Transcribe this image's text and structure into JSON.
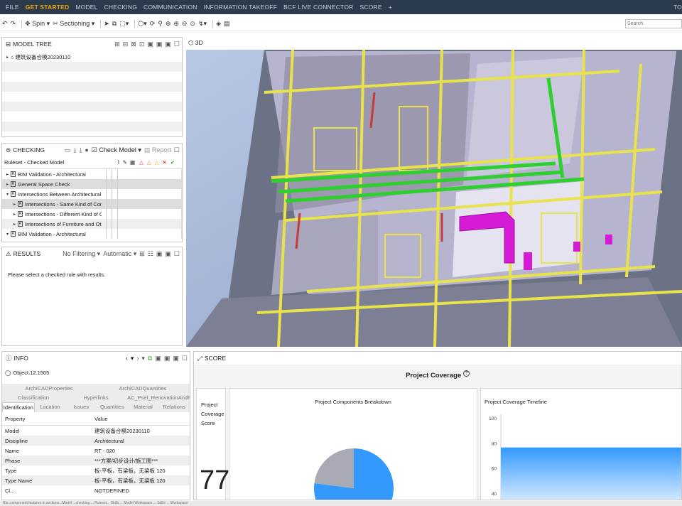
{
  "menu": {
    "items": [
      "FILE",
      "GET STARTED",
      "MODEL",
      "CHECKING",
      "COMMUNICATION",
      "INFORMATION TAKEOFF",
      "BCF LIVE CONNECTOR",
      "SCORE",
      "+"
    ],
    "right": "TO"
  },
  "toolbar": {
    "spin": "Spin",
    "sectioning": "Sectioning",
    "search_placeholder": "Search"
  },
  "model_tree": {
    "title": "MODEL TREE",
    "root": "建筑设备合模20230110"
  },
  "view3d": {
    "label": "3D"
  },
  "checking": {
    "title": "CHECKING",
    "check_model": "Check Model",
    "report": "Report",
    "col": "Ruleset - Checked Model",
    "rows": [
      "BIM Validation - Architectural",
      "General Space Check",
      "Intersections Between Architectural Compo",
      "Intersections - Same Kind of Componen",
      "Intersections - Different Kind of Compo",
      "Intersections of Furniture and Other Ob",
      "BIM Validation - Architectural"
    ]
  },
  "results": {
    "title": "RESULTS",
    "filter": "No Filtering",
    "mode": "Automatic",
    "message": "Please select a checked rule with results."
  },
  "info": {
    "title": "INFO",
    "object": "Object.12.1505",
    "tabs_row1": [
      "ArchiCADProperties",
      "ArchiCADQuantities"
    ],
    "tabs_row2": [
      "Classification",
      "Hyperlinks",
      "AC_Pset_RenovationAndPhasing"
    ],
    "tabs_row3": [
      "Identification",
      "Location",
      "Issues",
      "Quantities",
      "Material",
      "Relations"
    ],
    "col_property": "Property",
    "col_value": "Value",
    "rows": [
      [
        "Model",
        "建筑设备合模20230110"
      ],
      [
        "Discipline",
        "Architectural"
      ],
      [
        "Name",
        "RT - 020"
      ],
      [
        "Phase",
        "***方案/初步设计/施工图***"
      ],
      [
        "Type",
        "板-平板，有梁板，无梁板 120"
      ],
      [
        "Type Name",
        "板-平板，有梁板，无梁板 120"
      ],
      [
        "Cl...",
        "NOTDEFINED"
      ]
    ]
  },
  "score": {
    "title": "SCORE",
    "heading": "Project Coverage",
    "help": "?",
    "card_label": [
      "Project",
      "Coverage",
      "Score"
    ],
    "value": "77",
    "breakdown_title": "Project Components Breakdown",
    "timeline_title": "Project Coverage Timeline"
  },
  "chart_data": [
    {
      "type": "pie",
      "title": "Project Components Breakdown",
      "values": [
        77,
        23
      ],
      "colors": [
        "#3399ff",
        "#a8aab3"
      ]
    },
    {
      "type": "area",
      "title": "Project Coverage Timeline",
      "yticks": [
        100,
        80,
        60,
        40
      ],
      "ylim": [
        40,
        100
      ],
      "values": [
        77
      ],
      "color": "#3399ff"
    }
  ],
  "status": {
    "text": "Ris..component features in sections ..Model ...checking ... Ruleset... Skills ... Model Workspace ... Skills ... Workspace"
  }
}
